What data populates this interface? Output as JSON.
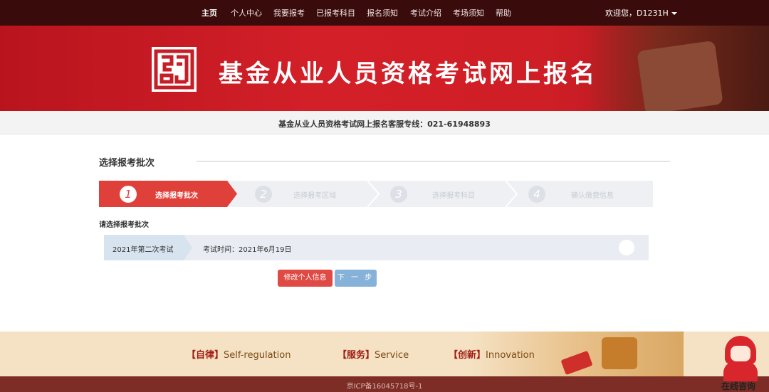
{
  "nav": {
    "items": [
      "主页",
      "个人中心",
      "我要报考",
      "已报考科目",
      "报名须知",
      "考试介绍",
      "考场须知",
      "帮助"
    ],
    "welcome": "欢迎您，D1231H"
  },
  "banner": {
    "title": "基金从业人员资格考试网上报名"
  },
  "hotline": "基金从业人员资格考试网上报名客服专线：021-61948893",
  "section_title": "选择报考批次",
  "steps": [
    {
      "num": "1",
      "label": "选择报考批次"
    },
    {
      "num": "2",
      "label": "选择报考区域"
    },
    {
      "num": "3",
      "label": "选择报考科目"
    },
    {
      "num": "4",
      "label": "确认缴费信息"
    }
  ],
  "prompt": "请选择报考批次",
  "batch": {
    "name": "2021年第二次考试",
    "time": "考试时间：2021年6月19日"
  },
  "buttons": {
    "edit": "修改个人信息",
    "next": "下 一 步"
  },
  "footer": {
    "mottos": [
      {
        "cn": "【自律】",
        "en": "Self-regulation"
      },
      {
        "cn": "【服务】",
        "en": "Service"
      },
      {
        "cn": "【创新】",
        "en": "Innovation"
      }
    ],
    "icp": "京ICP备16045718号-1",
    "consult": "在线咨询"
  },
  "colors": {
    "nav_bg": "#3a0b0b",
    "banner_red": "#d21f28",
    "step_active": "#e0403a",
    "btn_red": "#df4a45",
    "btn_blue": "#86b1d9"
  }
}
